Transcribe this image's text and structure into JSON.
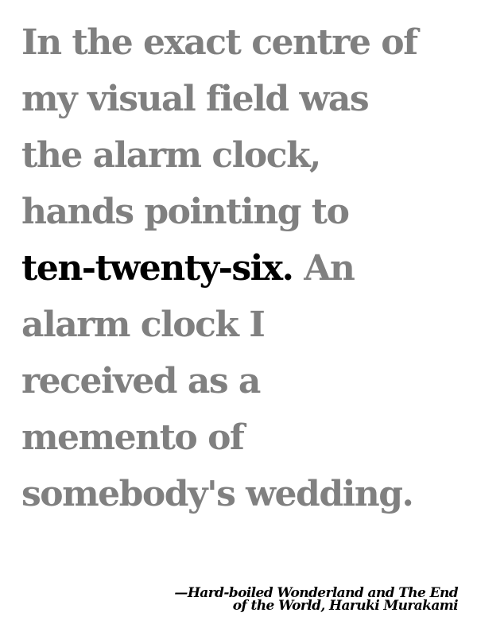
{
  "quote": {
    "lines": [
      "In the exact centre of",
      "my visual field was",
      "the alarm clock,",
      "hands pointing to"
    ],
    "highlight_time": "ten-twenty-six.",
    "after_highlight": " An",
    "lines_after": [
      "alarm clock I",
      "received as a",
      "memento of",
      "somebody's wedding."
    ]
  },
  "attribution": {
    "line1": "—Hard-boiled Wonderland and The End",
    "line2": "of the World, Haruki Murakami"
  },
  "colors": {
    "quote_text": "#808080",
    "highlight_text": "#000000",
    "background": "#ffffff"
  }
}
